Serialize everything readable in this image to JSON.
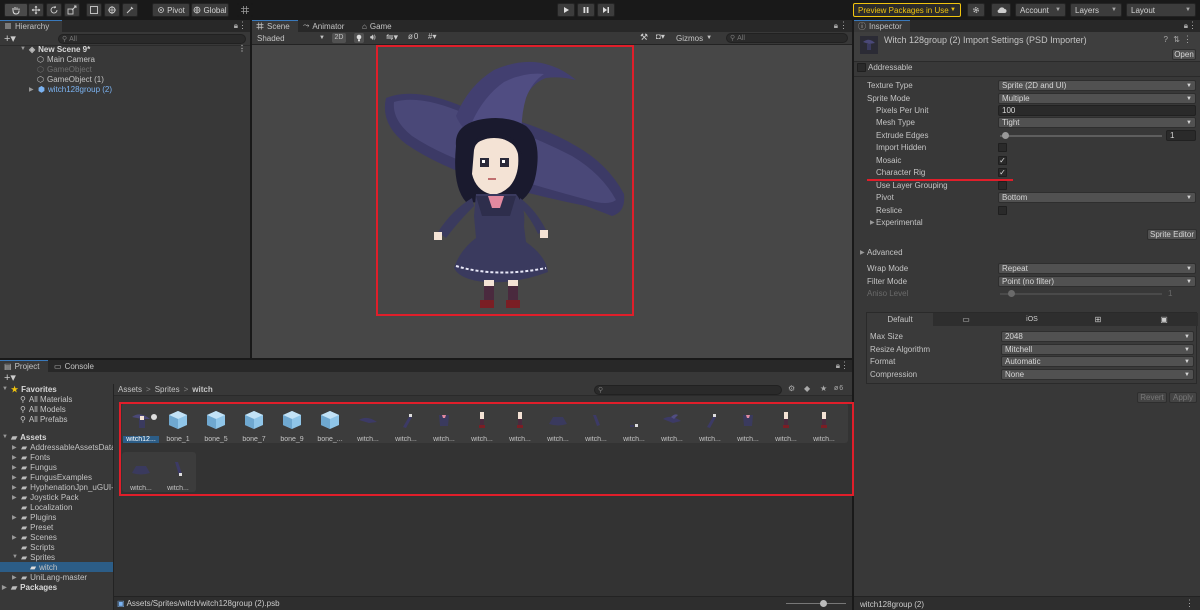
{
  "toolbar": {
    "pivot_label": "Pivot",
    "global_label": "Global",
    "preview_packages_label": "Preview Packages in Use",
    "account_label": "Account",
    "layers_label": "Layers",
    "layout_label": "Layout",
    "accent_color": "#f1c40f"
  },
  "hierarchy": {
    "tab_label": "Hierarchy",
    "search_placeholder": "All",
    "items": [
      {
        "label": "New Scene 9*"
      },
      {
        "label": "Main Camera"
      },
      {
        "label": "GameObject"
      },
      {
        "label": "GameObject (1)"
      },
      {
        "label": "witch128group (2)"
      }
    ]
  },
  "scene": {
    "tabs": [
      {
        "label": "Scene"
      },
      {
        "label": "Animator"
      },
      {
        "label": "Game"
      }
    ],
    "shading_mode": "Shaded",
    "mode_2d": "2D",
    "hidden_count": "0",
    "gizmos_label": "Gizmos",
    "search_placeholder": "All"
  },
  "inspector": {
    "tab_label": "Inspector",
    "title": "Witch 128group (2) Import Settings (PSD Importer)",
    "open_button": "Open",
    "addressable_label": "Addressable",
    "rows": {
      "texture_type": {
        "label": "Texture Type",
        "value": "Sprite (2D and UI)"
      },
      "sprite_mode": {
        "label": "Sprite Mode",
        "value": "Multiple"
      },
      "pixels_per_unit": {
        "label": "Pixels Per Unit",
        "value": "100"
      },
      "mesh_type": {
        "label": "Mesh Type",
        "value": "Tight"
      },
      "extrude_edges": {
        "label": "Extrude Edges",
        "value": "1"
      },
      "import_hidden": {
        "label": "Import Hidden"
      },
      "mosaic": {
        "label": "Mosaic",
        "check": "✓"
      },
      "character_rig": {
        "label": "Character Rig",
        "check": "✓"
      },
      "use_layer_grouping": {
        "label": "Use Layer Grouping"
      },
      "pivot": {
        "label": "Pivot",
        "value": "Bottom"
      },
      "reslice": {
        "label": "Reslice"
      },
      "experimental": {
        "label": "Experimental"
      }
    },
    "sprite_editor_button": "Sprite Editor",
    "advanced_label": "Advanced",
    "wrap_mode": {
      "label": "Wrap Mode",
      "value": "Repeat"
    },
    "filter_mode": {
      "label": "Filter Mode",
      "value": "Point (no filter)"
    },
    "aniso_level": {
      "label": "Aniso Level",
      "value": "1"
    },
    "platform_tabs": {
      "default": "Default",
      "ios": "iOS"
    },
    "max_size": {
      "label": "Max Size",
      "value": "2048"
    },
    "resize_algorithm": {
      "label": "Resize Algorithm",
      "value": "Mitchell"
    },
    "format": {
      "label": "Format",
      "value": "Automatic"
    },
    "compression": {
      "label": "Compression",
      "value": "None"
    },
    "revert_button": "Revert",
    "apply_button": "Apply",
    "footer_label": "witch128group (2)"
  },
  "project": {
    "tabs": [
      {
        "label": "Project"
      },
      {
        "label": "Console"
      }
    ],
    "favorites": {
      "label": "Favorites",
      "items": [
        "All Materials",
        "All Models",
        "All Prefabs"
      ]
    },
    "assets": {
      "label": "Assets",
      "folders": [
        "AddressableAssetsData",
        "Fonts",
        "Fungus",
        "FungusExamples",
        "HyphenationJpn_uGUI-",
        "Joystick Pack",
        "Localization",
        "Plugins",
        "Preset",
        "Scenes",
        "Scripts",
        "Sprites",
        "witch",
        "UniLang-master"
      ]
    },
    "packages_label": "Packages",
    "breadcrumb": [
      "Assets",
      "Sprites",
      "witch"
    ],
    "hidden_count": "6",
    "grid_items": [
      {
        "label": "witch12...",
        "icon": "psb-icon"
      },
      {
        "label": "bone_1",
        "icon": "bone-cube-icon"
      },
      {
        "label": "bone_5",
        "icon": "bone-cube-icon"
      },
      {
        "label": "bone_7",
        "icon": "bone-cube-icon"
      },
      {
        "label": "bone_9",
        "icon": "bone-cube-icon"
      },
      {
        "label": "bone_...",
        "icon": "bone-cube-icon"
      },
      {
        "label": "witch...",
        "icon": "sprite-hat-icon"
      },
      {
        "label": "witch...",
        "icon": "sprite-slash-icon"
      },
      {
        "label": "witch...",
        "icon": "sprite-cloth-icon"
      },
      {
        "label": "witch...",
        "icon": "sprite-leg-icon"
      },
      {
        "label": "witch...",
        "icon": "sprite-leg-icon"
      },
      {
        "label": "witch...",
        "icon": "sprite-skirt-icon"
      },
      {
        "label": "witch...",
        "icon": "sprite-slash-icon"
      },
      {
        "label": "witch...",
        "icon": "sprite-small-icon"
      },
      {
        "label": "witch...",
        "icon": "sprite-hat-icon"
      },
      {
        "label": "witch...",
        "icon": "sprite-slash-icon"
      },
      {
        "label": "witch...",
        "icon": "sprite-cloth-icon"
      },
      {
        "label": "witch...",
        "icon": "sprite-leg-icon"
      },
      {
        "label": "witch...",
        "icon": "sprite-leg-icon"
      },
      {
        "label": "witch...",
        "icon": "sprite-skirt-icon"
      },
      {
        "label": "witch...",
        "icon": "sprite-slash-icon"
      }
    ],
    "status_path": "Assets/Sprites/witch/witch128group (2).psb"
  },
  "highlight_color": "#e01e2a"
}
